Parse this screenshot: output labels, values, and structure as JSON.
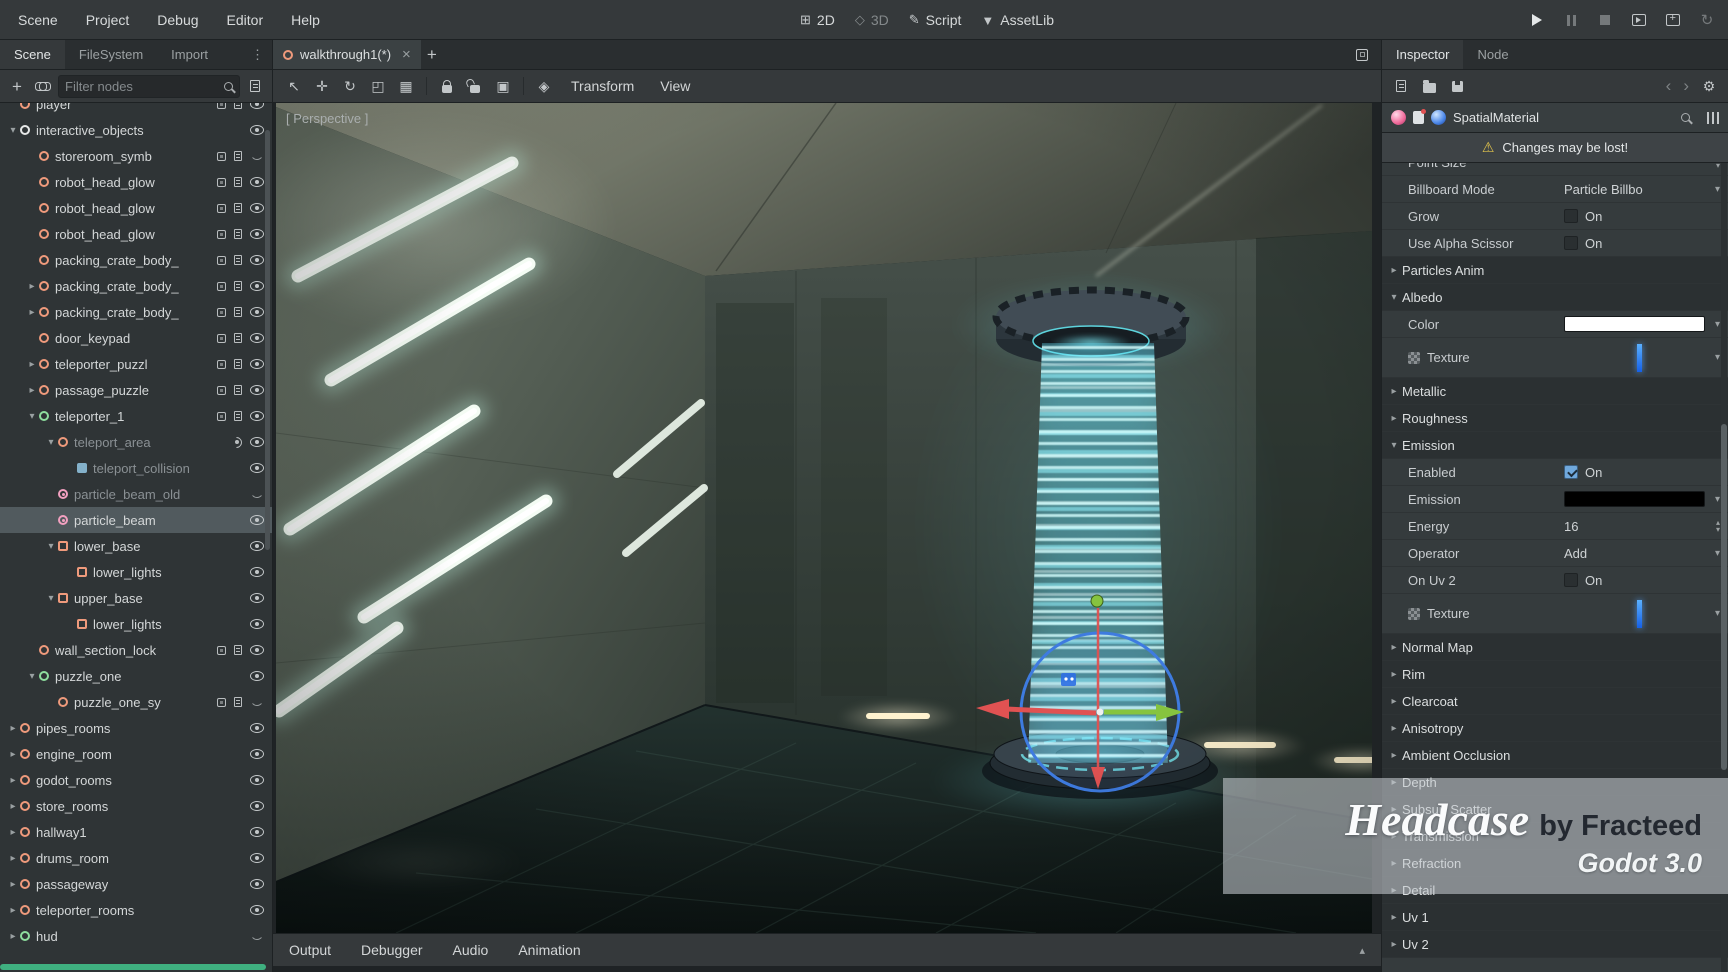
{
  "menubar": {
    "items": [
      "Scene",
      "Project",
      "Debug",
      "Editor",
      "Help"
    ],
    "modes": [
      {
        "label": "2D",
        "icon": "canvas-2d-icon",
        "dimmed": false
      },
      {
        "label": "3D",
        "icon": "spatial-3d-icon",
        "dimmed": true
      },
      {
        "label": "Script",
        "icon": "script-icon",
        "dimmed": false
      },
      {
        "label": "AssetLib",
        "icon": "assetlib-icon",
        "dimmed": false
      }
    ],
    "playback": [
      {
        "name": "play",
        "icon": "play-icon",
        "dimmed": false
      },
      {
        "name": "pause",
        "icon": "pause-icon",
        "dimmed": true
      },
      {
        "name": "stop",
        "icon": "stop-icon",
        "dimmed": true
      },
      {
        "name": "play-scene",
        "icon": "play-scene-icon",
        "dimmed": false
      },
      {
        "name": "play-custom-scene",
        "icon": "play-custom-scene-icon",
        "dimmed": false
      },
      {
        "name": "update-spinner",
        "icon": "reload-icon",
        "dimmed": true
      }
    ]
  },
  "left_dock": {
    "tabs": [
      {
        "label": "Scene",
        "active": true
      },
      {
        "label": "FileSystem",
        "active": false
      },
      {
        "label": "Import",
        "active": false
      }
    ],
    "toolbar_icons": [
      "add-node",
      "instance-scene",
      "attach-script"
    ],
    "filter_placeholder": "Filter nodes",
    "tree": [
      {
        "label": "player",
        "depth": 1,
        "icon": "spatial",
        "badges": [
          "group",
          "script"
        ],
        "vis": "open",
        "clipped": true
      },
      {
        "label": "interactive_objects",
        "depth": 1,
        "arrow": "open",
        "icon": "spatial-white",
        "vis": "open"
      },
      {
        "label": "storeroom_symb",
        "depth": 2,
        "icon": "spatial",
        "badges": [
          "group",
          "script"
        ],
        "vis": "closed"
      },
      {
        "label": "robot_head_glow",
        "depth": 2,
        "icon": "spatial",
        "badges": [
          "group",
          "script"
        ],
        "vis": "open"
      },
      {
        "label": "robot_head_glow",
        "depth": 2,
        "icon": "spatial",
        "badges": [
          "group",
          "script"
        ],
        "vis": "open"
      },
      {
        "label": "robot_head_glow",
        "depth": 2,
        "icon": "spatial",
        "badges": [
          "group",
          "script"
        ],
        "vis": "open"
      },
      {
        "label": "packing_crate_body_",
        "depth": 2,
        "icon": "spatial",
        "badges": [
          "group",
          "script"
        ],
        "vis": "open"
      },
      {
        "label": "packing_crate_body_",
        "depth": 2,
        "arrow": "closed",
        "icon": "spatial",
        "badges": [
          "group",
          "script"
        ],
        "vis": "open"
      },
      {
        "label": "packing_crate_body_",
        "depth": 2,
        "arrow": "closed",
        "icon": "spatial",
        "badges": [
          "group",
          "script"
        ],
        "vis": "open"
      },
      {
        "label": "door_keypad",
        "depth": 2,
        "icon": "spatial",
        "badges": [
          "group",
          "script"
        ],
        "vis": "open"
      },
      {
        "label": "teleporter_puzzl",
        "depth": 2,
        "arrow": "closed",
        "icon": "spatial",
        "badges": [
          "group",
          "script"
        ],
        "vis": "open"
      },
      {
        "label": "passage_puzzle",
        "depth": 2,
        "arrow": "closed",
        "icon": "spatial",
        "badges": [
          "group",
          "script"
        ],
        "vis": "open"
      },
      {
        "label": "teleporter_1",
        "depth": 2,
        "arrow": "open",
        "icon": "spatial-green",
        "badges": [
          "group",
          "script"
        ],
        "vis": "open"
      },
      {
        "label": "teleport_area",
        "depth": 3,
        "arrow": "open",
        "icon": "area",
        "badges": [
          "signal"
        ],
        "vis": "open",
        "dimmed": true
      },
      {
        "label": "teleport_collision",
        "depth": 4,
        "icon": "collision",
        "vis": "open",
        "dimmed": true
      },
      {
        "label": "particle_beam_old",
        "depth": 3,
        "icon": "particles",
        "vis": "closed",
        "dimmed": true
      },
      {
        "label": "particle_beam",
        "depth": 3,
        "icon": "particles",
        "vis": "open",
        "selected": true
      },
      {
        "label": "lower_base",
        "depth": 3,
        "arrow": "open",
        "icon": "mesh",
        "vis": "open"
      },
      {
        "label": "lower_lights",
        "depth": 4,
        "icon": "mesh",
        "vis": "open"
      },
      {
        "label": "upper_base",
        "depth": 3,
        "arrow": "open",
        "icon": "mesh",
        "vis": "open"
      },
      {
        "label": "lower_lights",
        "depth": 4,
        "icon": "mesh",
        "vis": "open"
      },
      {
        "label": "wall_section_lock",
        "depth": 2,
        "icon": "spatial",
        "badges": [
          "group",
          "script"
        ],
        "vis": "open"
      },
      {
        "label": "puzzle_one",
        "depth": 2,
        "arrow": "open",
        "icon": "spatial-green",
        "vis": "open"
      },
      {
        "label": "puzzle_one_sy",
        "depth": 3,
        "icon": "spatial",
        "badges": [
          "group",
          "script"
        ],
        "vis": "closed"
      },
      {
        "label": "pipes_rooms",
        "depth": 1,
        "arrow": "closed",
        "icon": "spatial",
        "vis": "open"
      },
      {
        "label": "engine_room",
        "depth": 1,
        "arrow": "closed",
        "icon": "spatial",
        "vis": "open"
      },
      {
        "label": "godot_rooms",
        "depth": 1,
        "arrow": "closed",
        "icon": "spatial",
        "vis": "open"
      },
      {
        "label": "store_rooms",
        "depth": 1,
        "arrow": "closed",
        "icon": "spatial",
        "vis": "open"
      },
      {
        "label": "hallway1",
        "depth": 1,
        "arrow": "closed",
        "icon": "spatial",
        "vis": "open"
      },
      {
        "label": "drums_room",
        "depth": 1,
        "arrow": "closed",
        "icon": "spatial",
        "vis": "open"
      },
      {
        "label": "passageway",
        "depth": 1,
        "arrow": "closed",
        "icon": "spatial",
        "vis": "open"
      },
      {
        "label": "teleporter_rooms",
        "depth": 1,
        "arrow": "closed",
        "icon": "spatial",
        "vis": "open"
      },
      {
        "label": "hud",
        "depth": 1,
        "arrow": "closed",
        "icon": "spatial-green",
        "vis": "closed"
      }
    ]
  },
  "scene_panel": {
    "tab_title": "walkthrough1(*)",
    "tab_icons": [
      "scene-node-icon",
      "close-tab",
      "new-scene-tab",
      "distraction-free"
    ],
    "toolbar_tools": [
      "select",
      "move",
      "rotate",
      "scale",
      "list-select",
      "lock",
      "unlock",
      "group",
      "snap"
    ],
    "menus": [
      "Transform",
      "View"
    ],
    "perspective_label": "[ Perspective ]",
    "bottom_tabs": [
      "Output",
      "Debugger",
      "Audio",
      "Animation"
    ]
  },
  "inspector": {
    "tabs": [
      {
        "label": "Inspector",
        "active": true
      },
      {
        "label": "Node",
        "active": false
      }
    ],
    "toolbar_icons": {
      "left": [
        "new-resource",
        "load-resource",
        "save-resource"
      ],
      "right": [
        "history-back",
        "history-forward",
        "object-tools"
      ]
    },
    "resource": {
      "name": "SpatialMaterial",
      "icons": [
        "material-ball-pink",
        "resource-badge",
        "material-ball-blue"
      ],
      "right_icons": [
        "search",
        "edit-filters"
      ]
    },
    "warning": "Changes may be lost!",
    "rows": [
      {
        "type": "property",
        "label": "Point Size",
        "value": {
          "kind": "number",
          "text": ""
        },
        "clipped": true
      },
      {
        "type": "property",
        "label": "Billboard Mode",
        "value": {
          "kind": "dropdown",
          "text": "Particle Billbo"
        }
      },
      {
        "type": "property",
        "label": "Grow",
        "value": {
          "kind": "checkbox",
          "text": "On",
          "checked": false
        }
      },
      {
        "type": "property",
        "label": "Use Alpha Scissor",
        "value": {
          "kind": "checkbox",
          "text": "On",
          "checked": false
        }
      },
      {
        "type": "section",
        "label": "Particles Anim",
        "state": "collapsed"
      },
      {
        "type": "section",
        "label": "Albedo",
        "state": "expanded"
      },
      {
        "type": "property",
        "label": "Color",
        "value": {
          "kind": "color",
          "color": "#ffffff"
        }
      },
      {
        "type": "property",
        "label": "Texture",
        "icon": "texture-checker",
        "value": {
          "kind": "texture"
        },
        "tall": true
      },
      {
        "type": "section",
        "label": "Metallic",
        "state": "collapsed"
      },
      {
        "type": "section",
        "label": "Roughness",
        "state": "collapsed"
      },
      {
        "type": "section",
        "label": "Emission",
        "state": "expanded"
      },
      {
        "type": "property",
        "label": "Enabled",
        "value": {
          "kind": "checkbox",
          "text": "On",
          "checked": true
        }
      },
      {
        "type": "property",
        "label": "Emission",
        "value": {
          "kind": "color",
          "color": "#000000"
        }
      },
      {
        "type": "property",
        "label": "Energy",
        "value": {
          "kind": "number",
          "text": "16"
        }
      },
      {
        "type": "property",
        "label": "Operator",
        "value": {
          "kind": "dropdown",
          "text": "Add"
        }
      },
      {
        "type": "property",
        "label": "On Uv 2",
        "value": {
          "kind": "checkbox",
          "text": "On",
          "checked": false
        }
      },
      {
        "type": "property",
        "label": "Texture",
        "icon": "texture-checker",
        "value": {
          "kind": "texture"
        },
        "tall": true
      },
      {
        "type": "section",
        "label": "Normal Map",
        "state": "collapsed"
      },
      {
        "type": "section",
        "label": "Rim",
        "state": "collapsed"
      },
      {
        "type": "section",
        "label": "Clearcoat",
        "state": "collapsed"
      },
      {
        "type": "section",
        "label": "Anisotropy",
        "state": "collapsed"
      },
      {
        "type": "section",
        "label": "Ambient Occlusion",
        "state": "collapsed"
      },
      {
        "type": "section",
        "label": "Depth",
        "state": "collapsed"
      },
      {
        "type": "section",
        "label": "Subsurf Scatter",
        "state": "collapsed"
      },
      {
        "type": "section",
        "label": "Transmission",
        "state": "collapsed"
      },
      {
        "type": "section",
        "label": "Refraction",
        "state": "collapsed"
      },
      {
        "type": "section",
        "label": "Detail",
        "state": "collapsed"
      },
      {
        "type": "section",
        "label": "Uv 1",
        "state": "collapsed"
      },
      {
        "type": "section",
        "label": "Uv 2",
        "state": "collapsed"
      }
    ]
  },
  "watermark": {
    "title": "Headcase",
    "byline": "by Fracteed",
    "version": "Godot 3.0"
  }
}
